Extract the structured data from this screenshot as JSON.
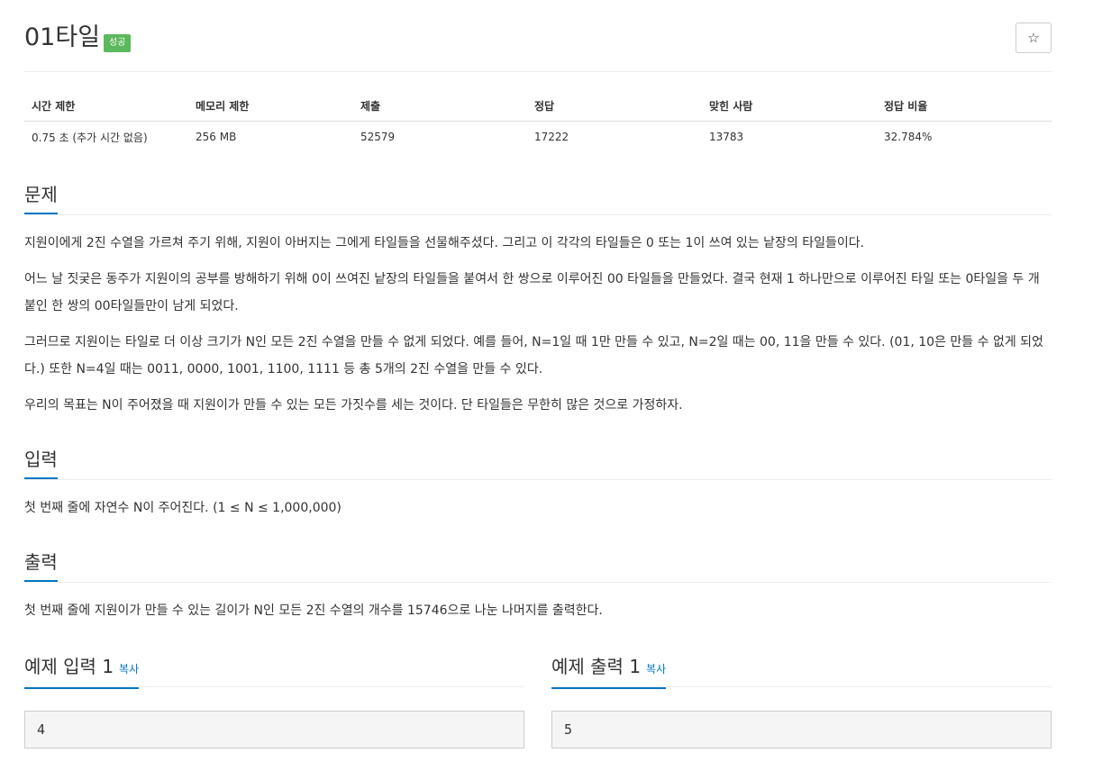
{
  "problem": {
    "title": "01타일",
    "status_badge": "성공",
    "star_icon": "☆"
  },
  "info": {
    "headers": [
      "시간 제한",
      "메모리 제한",
      "제출",
      "정답",
      "맞힌 사람",
      "정답 비율"
    ],
    "values": [
      "0.75 초 (추가 시간 없음)",
      "256 MB",
      "52579",
      "17222",
      "13783",
      "32.784%"
    ]
  },
  "description": {
    "title": "문제",
    "paragraphs": [
      "지원이에게 2진 수열을 가르쳐 주기 위해, 지원이 아버지는 그에게 타일들을 선물해주셨다. 그리고 이 각각의 타일들은 0 또는 1이 쓰여 있는 낱장의 타일들이다.",
      "어느 날 짓궂은 동주가 지원이의 공부를 방해하기 위해 0이 쓰여진 낱장의 타일들을 붙여서 한 쌍으로 이루어진 00 타일들을 만들었다. 결국 현재 1 하나만으로 이루어진 타일 또는 0타일을 두 개 붙인 한 쌍의 00타일들만이 남게 되었다.",
      "그러므로 지원이는 타일로 더 이상 크기가 N인 모든 2진 수열을 만들 수 없게 되었다. 예를 들어, N=1일 때 1만 만들 수 있고, N=2일 때는 00, 11을 만들 수 있다. (01, 10은 만들 수 없게 되었다.) 또한 N=4일 때는 0011, 0000, 1001, 1100, 1111 등 총 5개의 2진 수열을 만들 수 있다.",
      "우리의 목표는 N이 주어졌을 때 지원이가 만들 수 있는 모든 가짓수를 세는 것이다. 단 타일들은 무한히 많은 것으로 가정하자."
    ]
  },
  "input": {
    "title": "입력",
    "text": "첫 번째 줄에 자연수 N이 주어진다. (1 ≤ N ≤ 1,000,000)"
  },
  "output": {
    "title": "출력",
    "text": "첫 번째 줄에 지원이가 만들 수 있는 길이가 N인 모든 2진 수열의 개수를 15746으로 나눈 나머지를 출력한다."
  },
  "samples": [
    {
      "title": "예제 입력 1",
      "copy_label": "복사",
      "value": "4"
    },
    {
      "title": "예제 출력 1",
      "copy_label": "복사",
      "value": "5"
    }
  ],
  "colors": {
    "accent": "#0076c0",
    "success": "#5cb85c"
  }
}
